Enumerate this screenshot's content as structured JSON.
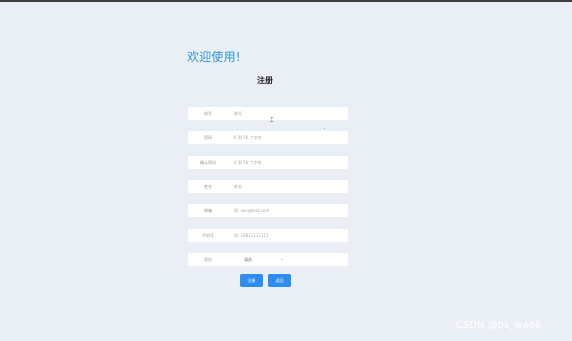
{
  "welcome": "欢迎使用!",
  "title": "注册",
  "fields": [
    {
      "label": "账号",
      "value": "账号"
    },
    {
      "label": "密码",
      "value": "6 到 16 个字符"
    },
    {
      "label": "确认密码",
      "value": "6 到 16 个字符"
    },
    {
      "label": "姓名",
      "value": "姓名"
    },
    {
      "label": "邮箱",
      "value": "如: xxx@test.com"
    },
    {
      "label": "手机号",
      "value": "如: 18811111111"
    }
  ],
  "role": {
    "label": "身份",
    "value": "请选"
  },
  "buttons": {
    "register": "注册",
    "back": "返回"
  },
  "watermark": "CSDN @bs_wa66"
}
